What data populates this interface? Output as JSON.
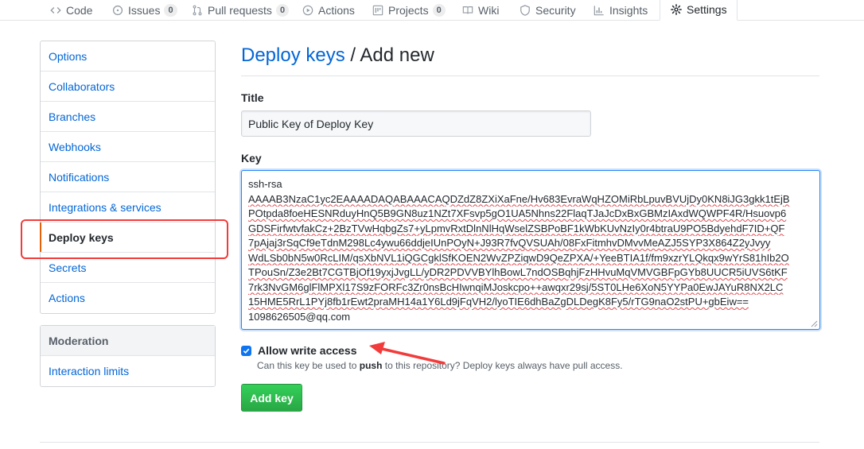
{
  "repo_nav": {
    "tabs": [
      {
        "label": "Code",
        "icon": "code-icon",
        "count": null
      },
      {
        "label": "Issues",
        "icon": "issue-icon",
        "count": "0"
      },
      {
        "label": "Pull requests",
        "icon": "pull-request-icon",
        "count": "0"
      },
      {
        "label": "Actions",
        "icon": "play-icon",
        "count": null
      },
      {
        "label": "Projects",
        "icon": "project-icon",
        "count": "0"
      },
      {
        "label": "Wiki",
        "icon": "book-icon",
        "count": null
      },
      {
        "label": "Security",
        "icon": "shield-icon",
        "count": null
      },
      {
        "label": "Insights",
        "icon": "graph-icon",
        "count": null
      },
      {
        "label": "Settings",
        "icon": "gear-icon",
        "count": null,
        "selected": true
      }
    ]
  },
  "sidebar": {
    "items": [
      {
        "label": "Options"
      },
      {
        "label": "Collaborators"
      },
      {
        "label": "Branches"
      },
      {
        "label": "Webhooks"
      },
      {
        "label": "Notifications"
      },
      {
        "label": "Integrations & services"
      },
      {
        "label": "Deploy keys",
        "selected": true
      },
      {
        "label": "Secrets"
      },
      {
        "label": "Actions"
      }
    ],
    "moderation": {
      "heading": "Moderation",
      "items": [
        {
          "label": "Interaction limits"
        }
      ]
    }
  },
  "page": {
    "breadcrumb_link": "Deploy keys",
    "breadcrumb_rest": " / Add new"
  },
  "form": {
    "title_label": "Title",
    "title_value": "Public Key of Deploy Key",
    "key_label": "Key",
    "key_lines": [
      "ssh-rsa",
      "AAAAB3NzaC1yc2EAAAADAQABAAACAQDZdZ8ZXiXaFne/Hv683EvraWqHZOMiRbLpuvBVUjDy0KN8iJG3gkk1tEjB",
      "POtpda8foeHESNRduyHnQ5B9GN8uz1NZt7XFsvp5gO1UA5Nhns22FlaqTJaJcDxBxGBMzIAxdWQWPF4R/Hsuovp6",
      "GDSFirfwtvfakCz+2BzTVwHqbgZs7+yLpmvRxtDlnNlHqWselZSBPoBF1kWbKUvNzIy0r4btraU9PO5BdyehdF7ID+QF",
      "7pAjaj3rSqCf9eTdnM298Lc4ywu66ddjeIUnPOyN+J93R7fvQVSUAh/08FxFitmhvDMvvMeAZJ5SYP3X864Z2yJvyy",
      "WdLSb0bN5w0RcLIM/qsXbNVL1iQGCgklSfKOEN2WvZPZiqwD9QeZPXA/+YeeBTIA1f/fm9xzrYLQkqx9wYrS81hIb2O",
      "TPouSn/Z3e2Bt7CGTBjOf19yxjJvgLL/yDR2PDVVBYlhBowL7ndOSBqhjFzHHvuMqVMVGBFpGYb8UUCR5iUVS6tKF",
      "7rk3NvGM6glFlMPXl17S9zFORFc3Zr0nsBcHIwnqiMJoskcpo++awqxr29sj/5ST0LHe6XoN5YYPa0EwJAYuR8NX2LC",
      "15HME5RrL1PYj8fb1rEwt2praMH14a1Y6Ld9jFqVH2/lyoTIE6dhBaZgDLDegK8Fy5/rTG9naO2stPU+gbEiw==",
      "1098626505@qq.com"
    ],
    "write_access_label": "Allow write access",
    "write_access_checked": true,
    "write_access_note_pre": "Can this key be used to ",
    "write_access_note_bold": "push",
    "write_access_note_post": " to this repository? Deploy keys always have pull access.",
    "submit_label": "Add key"
  },
  "colors": {
    "link": "#0366d6",
    "accent_selected": "#e36209",
    "primary_button": "#28a745",
    "annotation_red": "#f23c3c"
  }
}
